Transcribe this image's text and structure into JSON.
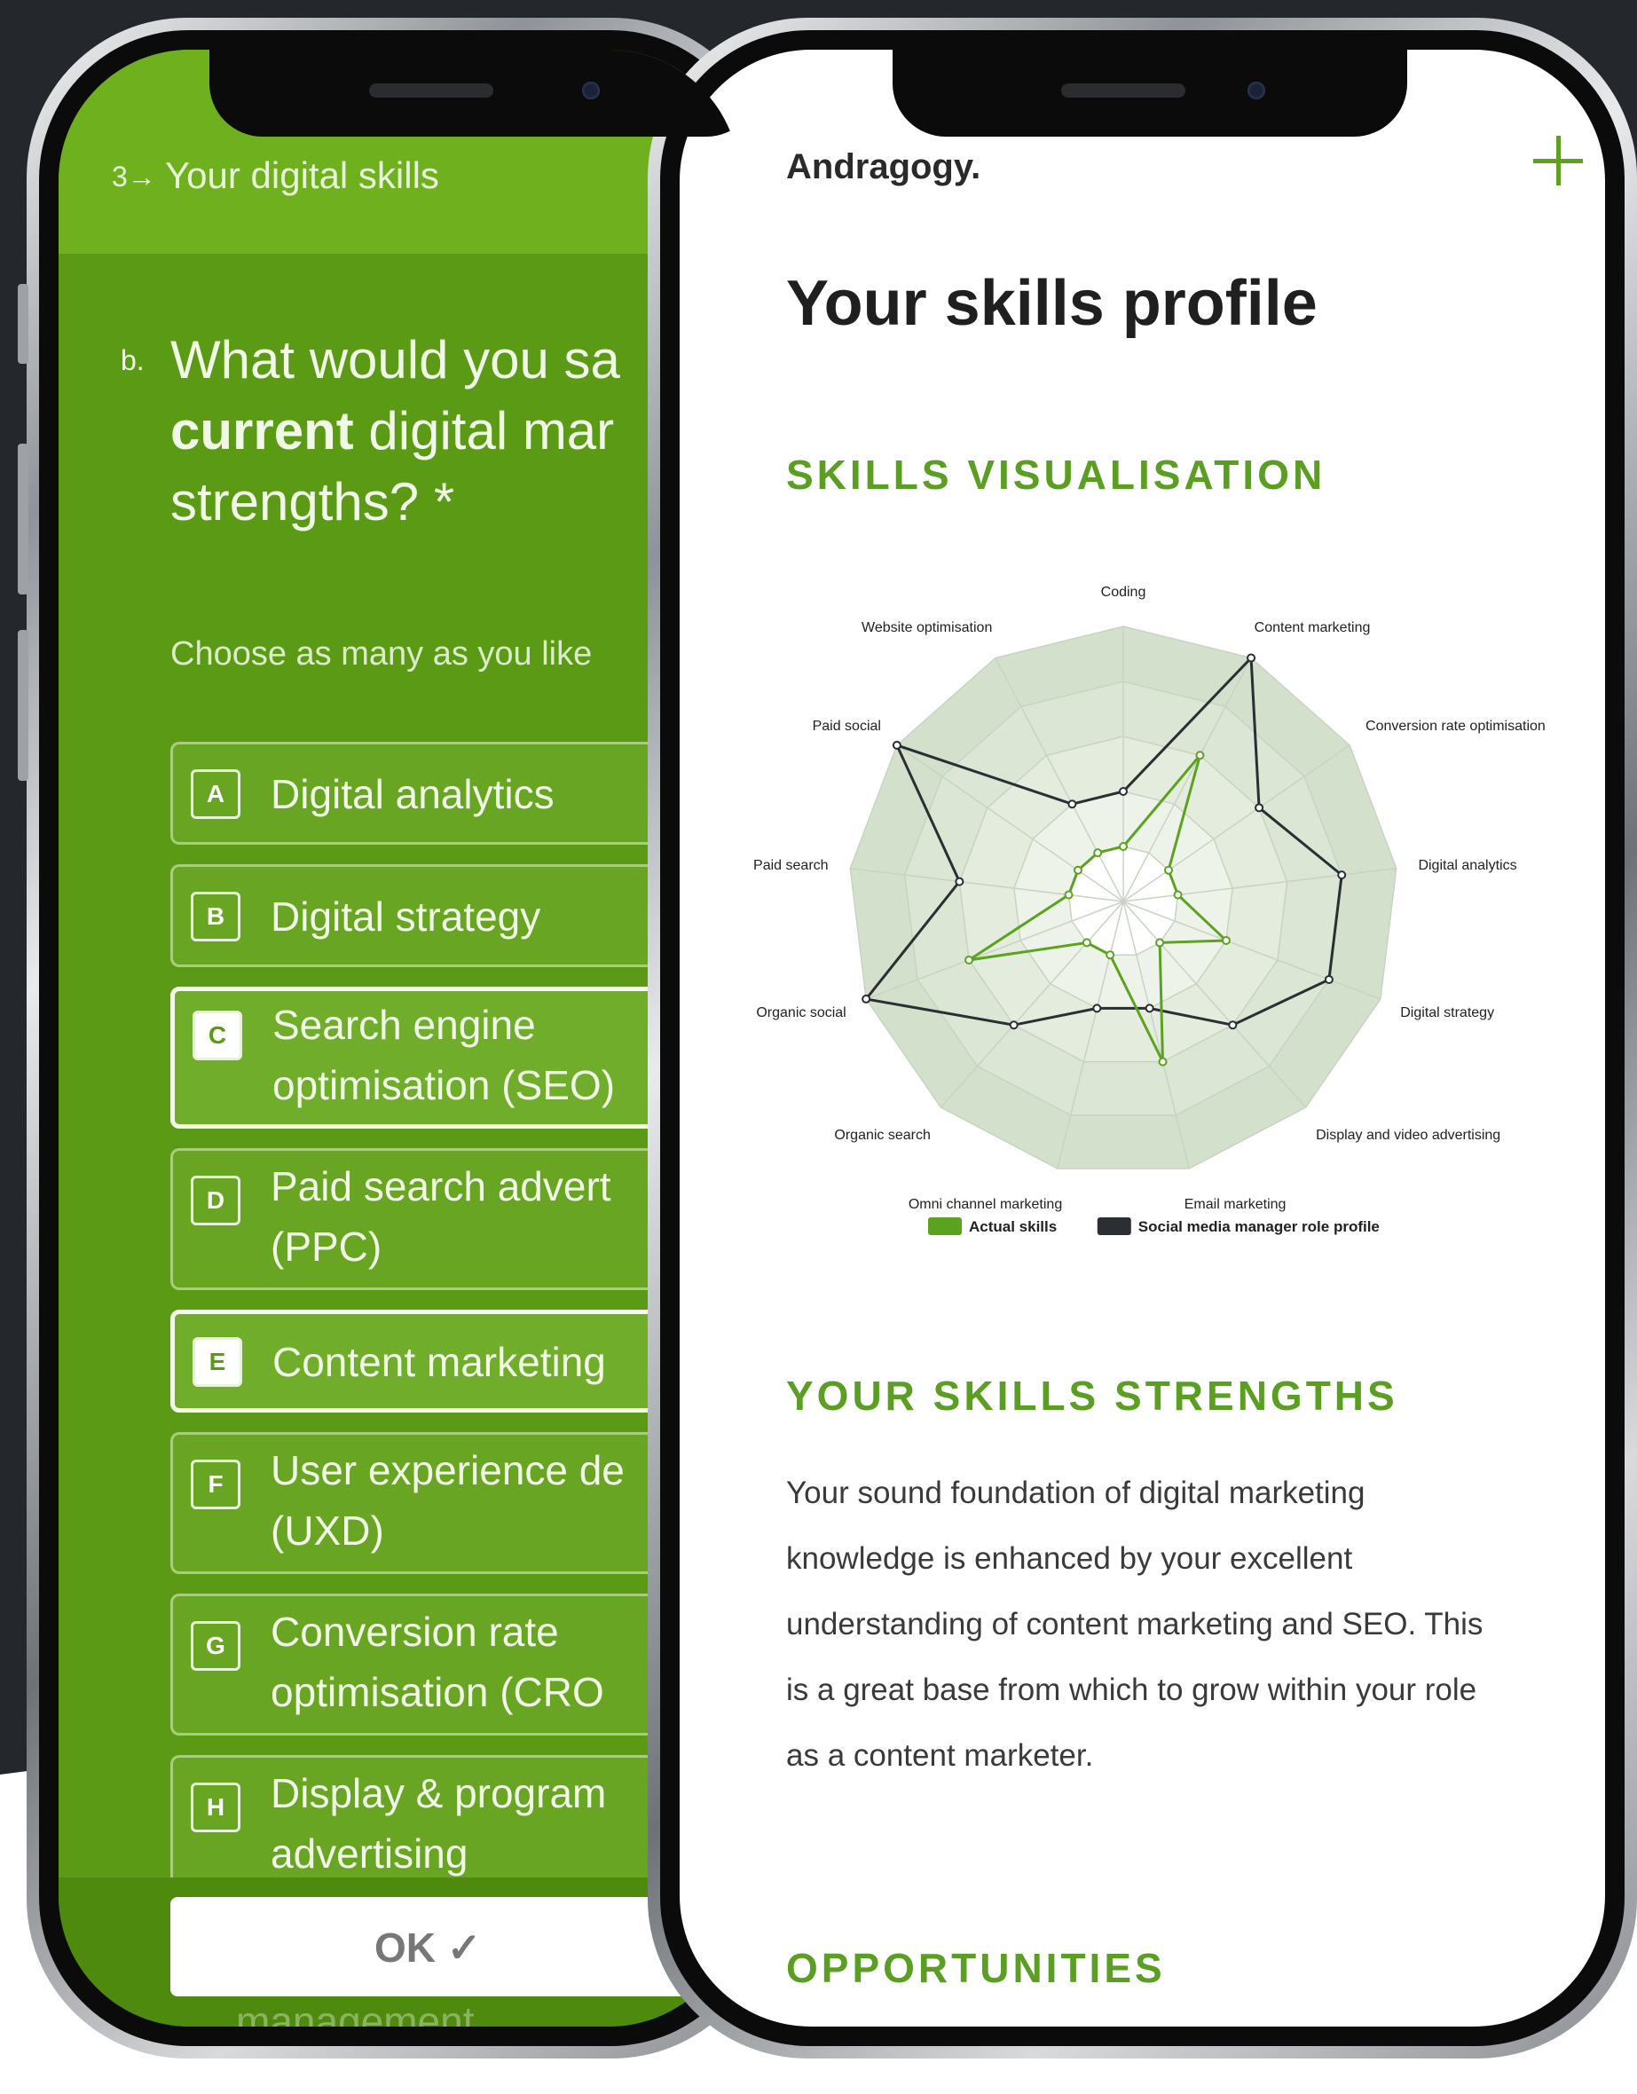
{
  "left_phone": {
    "header_number": "3→",
    "header_text": "Your digital skills",
    "question_letter": "b.",
    "question_line1": "What would you sa",
    "question_bold": "current",
    "question_line2_rest": " digital mar",
    "question_line3": "strengths? *",
    "hint": "Choose as many as you like",
    "options": [
      {
        "key": "A",
        "line1": "Digital analytics",
        "line2": "",
        "selected": false
      },
      {
        "key": "B",
        "line1": "Digital strategy",
        "line2": "",
        "selected": false
      },
      {
        "key": "C",
        "line1": "Search engine",
        "line2": "optimisation (SEO)",
        "selected": true
      },
      {
        "key": "D",
        "line1": "Paid search advert",
        "line2": "(PPC)",
        "selected": false
      },
      {
        "key": "E",
        "line1": "Content marketing",
        "line2": "",
        "selected": true
      },
      {
        "key": "F",
        "line1": "User experience de",
        "line2": "(UXD)",
        "selected": false
      },
      {
        "key": "G",
        "line1": "Conversion rate",
        "line2": "optimisation (CRO",
        "selected": false
      },
      {
        "key": "H",
        "line1": "Display & program",
        "line2": "advertising",
        "selected": false
      }
    ],
    "ok_label": "OK ✓",
    "ghost_text": "management"
  },
  "right_phone": {
    "logo": "Andragogy.",
    "plus_icon": "plus-icon",
    "title": "Your skills profile",
    "section1": "SKILLS VISUALISATION",
    "section2": "YOUR SKILLS STRENGTHS",
    "paragraph_lines": [
      "Your sound foundation of digital marketing",
      "knowledge is enhanced by your excellent",
      "understanding of content marketing and SEO. This",
      "is a great base from which to grow within your role",
      "as a content marketer."
    ],
    "section3": "OPPORTUNITIES"
  },
  "chart_data": {
    "type": "radar",
    "categories": [
      "Coding",
      "Content marketing",
      "Conversion rate optimisation",
      "Digital analytics",
      "Digital strategy",
      "Display and video advertising",
      "Email marketing",
      "Omni channel marketing",
      "Organic search",
      "Organic social",
      "Paid search",
      "Paid social",
      "Website optimisation"
    ],
    "rings": 5,
    "series": [
      {
        "name": "Actual skills",
        "color": "#5ba21f",
        "values": [
          1,
          3,
          1,
          1,
          2,
          1,
          3,
          1,
          1,
          3,
          1,
          1,
          1
        ]
      },
      {
        "name": "Social media manager role profile",
        "color": "#2b2e33",
        "values": [
          2,
          5,
          3,
          4,
          4,
          3,
          2,
          2,
          3,
          5,
          3,
          5,
          2
        ]
      }
    ],
    "legend": "bottom"
  }
}
